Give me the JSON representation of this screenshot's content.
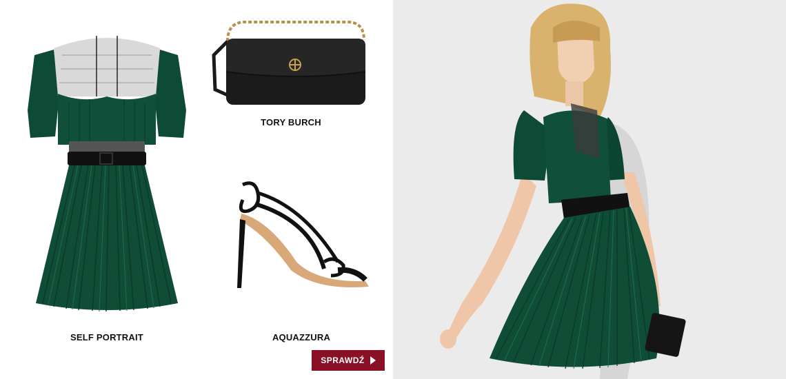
{
  "products": [
    {
      "brand": "SELF PORTRAIT",
      "item_icon": "green-pleated-dress-image"
    },
    {
      "brand": "TORY BURCH",
      "item_icon": "black-chain-bag-image"
    },
    {
      "brand": "AQUAZZURA",
      "item_icon": "black-strappy-sandal-image"
    }
  ],
  "cta": {
    "label": "SPRAWDŹ",
    "icon": "play-arrow-icon"
  },
  "colors": {
    "accent": "#8a1026",
    "dress_green": "#0d4a35",
    "background": "#ffffff",
    "photo_bg": "#ebebeb"
  },
  "hero": {
    "image_icon": "model-photo"
  }
}
